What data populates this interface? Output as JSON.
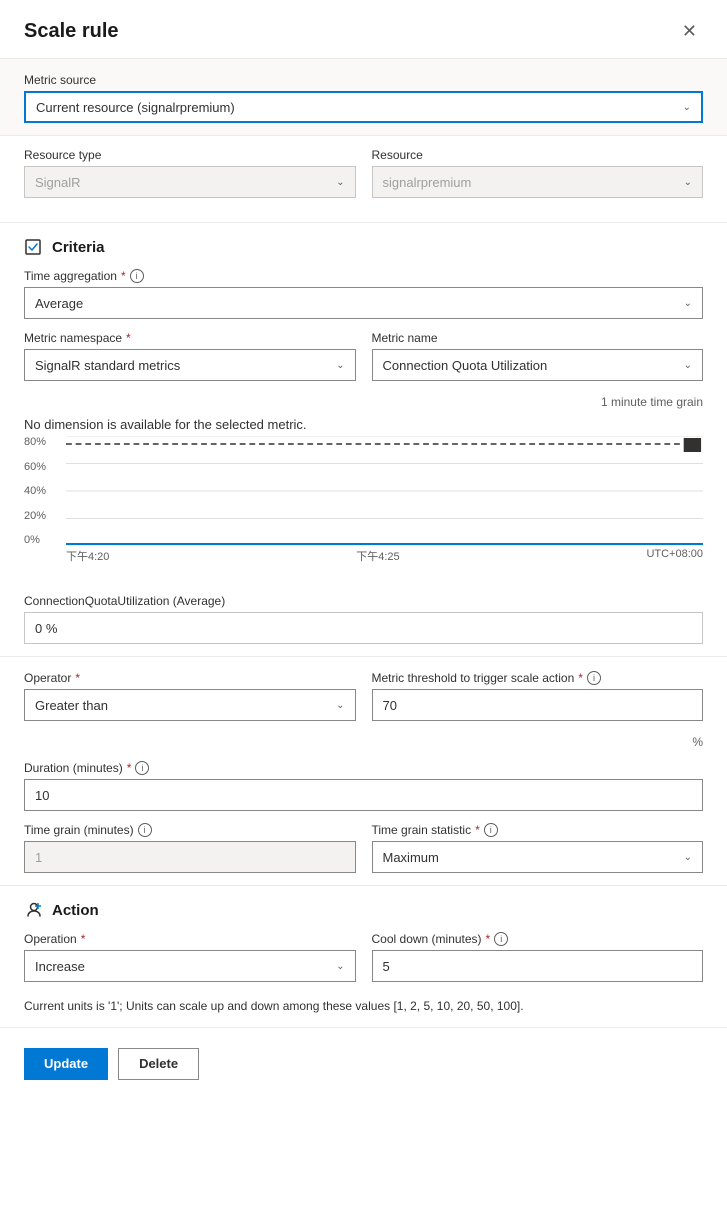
{
  "header": {
    "title": "Scale rule",
    "close_label": "✕"
  },
  "metric_source": {
    "label": "Metric source",
    "value": "Current resource (signalrpremium)"
  },
  "resource_type": {
    "label": "Resource type",
    "value": "SignalR"
  },
  "resource": {
    "label": "Resource",
    "value": "signalrpremium"
  },
  "criteria": {
    "heading": "Criteria",
    "time_aggregation": {
      "label": "Time aggregation",
      "value": "Average"
    },
    "metric_namespace": {
      "label": "Metric namespace",
      "value": "SignalR standard metrics"
    },
    "metric_name": {
      "label": "Metric name",
      "value": "Connection Quota Utilization"
    },
    "time_grain_note": "1 minute time grain",
    "no_dimension": "No dimension is available for the selected metric.",
    "chart": {
      "y_labels": [
        "80%",
        "60%",
        "40%",
        "20%",
        "0%"
      ],
      "x_labels": [
        "下午4:20",
        "下午4:25",
        "UTC+08:00"
      ]
    },
    "metric_value_label": "ConnectionQuotaUtilization (Average)",
    "metric_value": "0 %"
  },
  "operator": {
    "label": "Operator",
    "value": "Greater than"
  },
  "metric_threshold": {
    "label": "Metric threshold to trigger scale action",
    "value": "70",
    "unit": "%"
  },
  "duration": {
    "label": "Duration (minutes)",
    "value": "10"
  },
  "time_grain": {
    "label": "Time grain (minutes)",
    "value": "1"
  },
  "time_grain_statistic": {
    "label": "Time grain statistic",
    "value": "Maximum"
  },
  "action": {
    "heading": "Action",
    "operation": {
      "label": "Operation",
      "value": "Increase"
    },
    "cool_down": {
      "label": "Cool down (minutes)",
      "value": "5"
    },
    "units_note": "Current units is '1'; Units can scale up and down among these values [1, 2, 5, 10, 20, 50, 100]."
  },
  "footer": {
    "update_label": "Update",
    "delete_label": "Delete"
  }
}
